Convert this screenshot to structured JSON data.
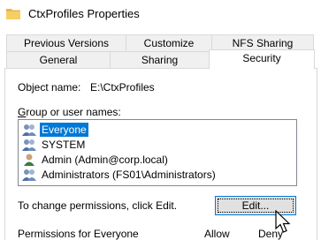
{
  "window": {
    "title": "CtxProfiles Properties"
  },
  "tabs": {
    "row1": [
      "Previous Versions",
      "Customize",
      "NFS Sharing"
    ],
    "row2": [
      "General",
      "Sharing",
      "Security"
    ],
    "active": "Security"
  },
  "security": {
    "object_name_label": "Object name:",
    "object_name_value": "E:\\CtxProfiles",
    "groups_label": "Group or user names:",
    "groups": [
      {
        "name": "Everyone",
        "icon": "users-group-icon",
        "selected": true
      },
      {
        "name": "SYSTEM",
        "icon": "users-group-icon",
        "selected": false
      },
      {
        "name": "Admin (Admin@corp.local)",
        "icon": "user-icon",
        "selected": false
      },
      {
        "name": "Administrators (FS01\\Administrators)",
        "icon": "users-group-icon",
        "selected": false
      }
    ],
    "change_permissions_text": "To change permissions, click Edit.",
    "edit_button": "Edit...",
    "permissions_for_label": "Permissions for Everyone",
    "allow_header": "Allow",
    "deny_header": "Deny"
  }
}
